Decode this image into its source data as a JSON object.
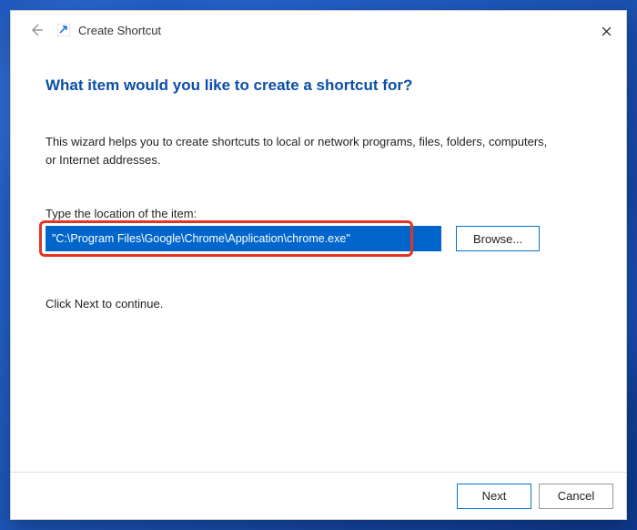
{
  "titlebar": {
    "title": "Create Shortcut"
  },
  "content": {
    "heading": "What item would you like to create a shortcut for?",
    "description": "This wizard helps you to create shortcuts to local or network programs, files, folders, computers, or Internet addresses.",
    "input_label": "Type the location of the item:",
    "location_value": "\"C:\\Program Files\\Google\\Chrome\\Application\\chrome.exe\"",
    "browse_label": "Browse...",
    "continue_text": "Click Next to continue."
  },
  "footer": {
    "next_label": "Next",
    "cancel_label": "Cancel"
  }
}
